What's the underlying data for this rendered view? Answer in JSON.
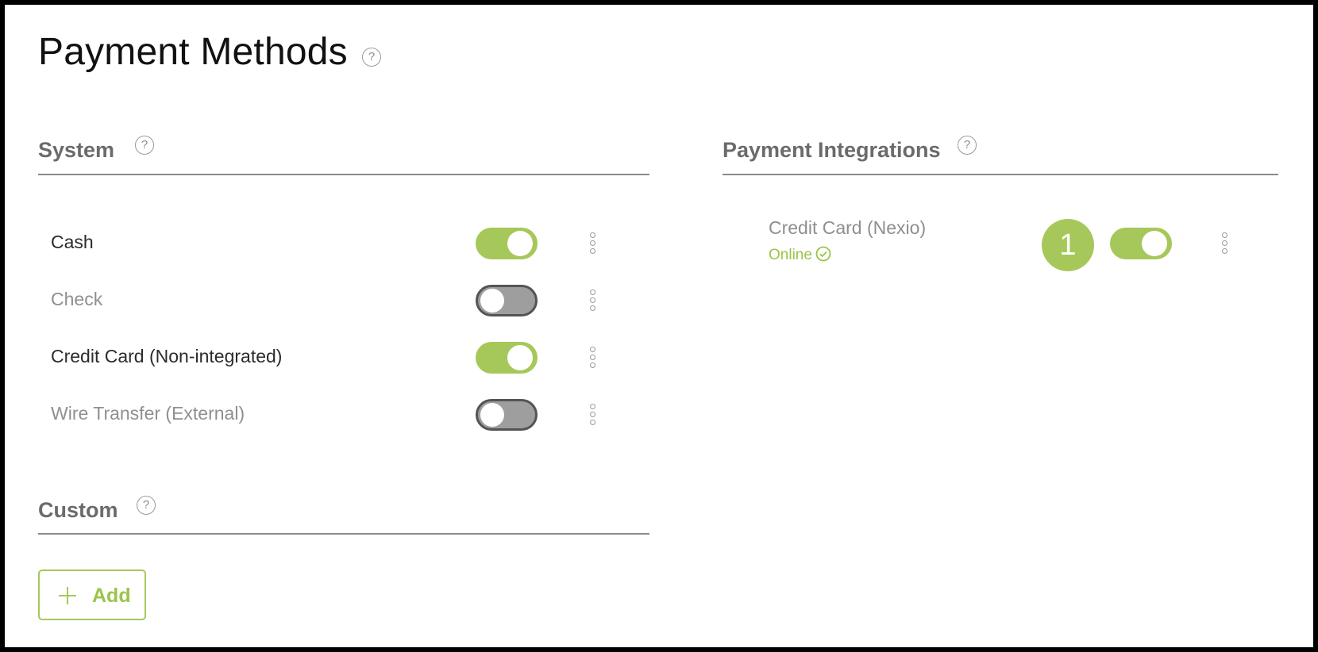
{
  "page": {
    "title": "Payment Methods",
    "help_icon": "question-circle-icon"
  },
  "system": {
    "title": "System",
    "items": [
      {
        "label": "Cash",
        "enabled": true
      },
      {
        "label": "Check",
        "enabled": false
      },
      {
        "label": "Credit Card (Non-integrated)",
        "enabled": true
      },
      {
        "label": "Wire Transfer (External)",
        "enabled": false
      }
    ]
  },
  "custom": {
    "title": "Custom",
    "add_label": "Add",
    "add_icon": "plus-icon"
  },
  "integrations": {
    "title": "Payment Integrations",
    "items": [
      {
        "label": "Credit Card (Nexio)",
        "status": "Online",
        "status_icon": "check-circle-icon",
        "badge": "1",
        "enabled": true
      }
    ]
  },
  "help_glyph": "?",
  "colors": {
    "accent": "#a6c85a",
    "status_online": "#9ac44a",
    "toggle_off": "#9e9e9e",
    "section_title": "#6b6b6b"
  }
}
